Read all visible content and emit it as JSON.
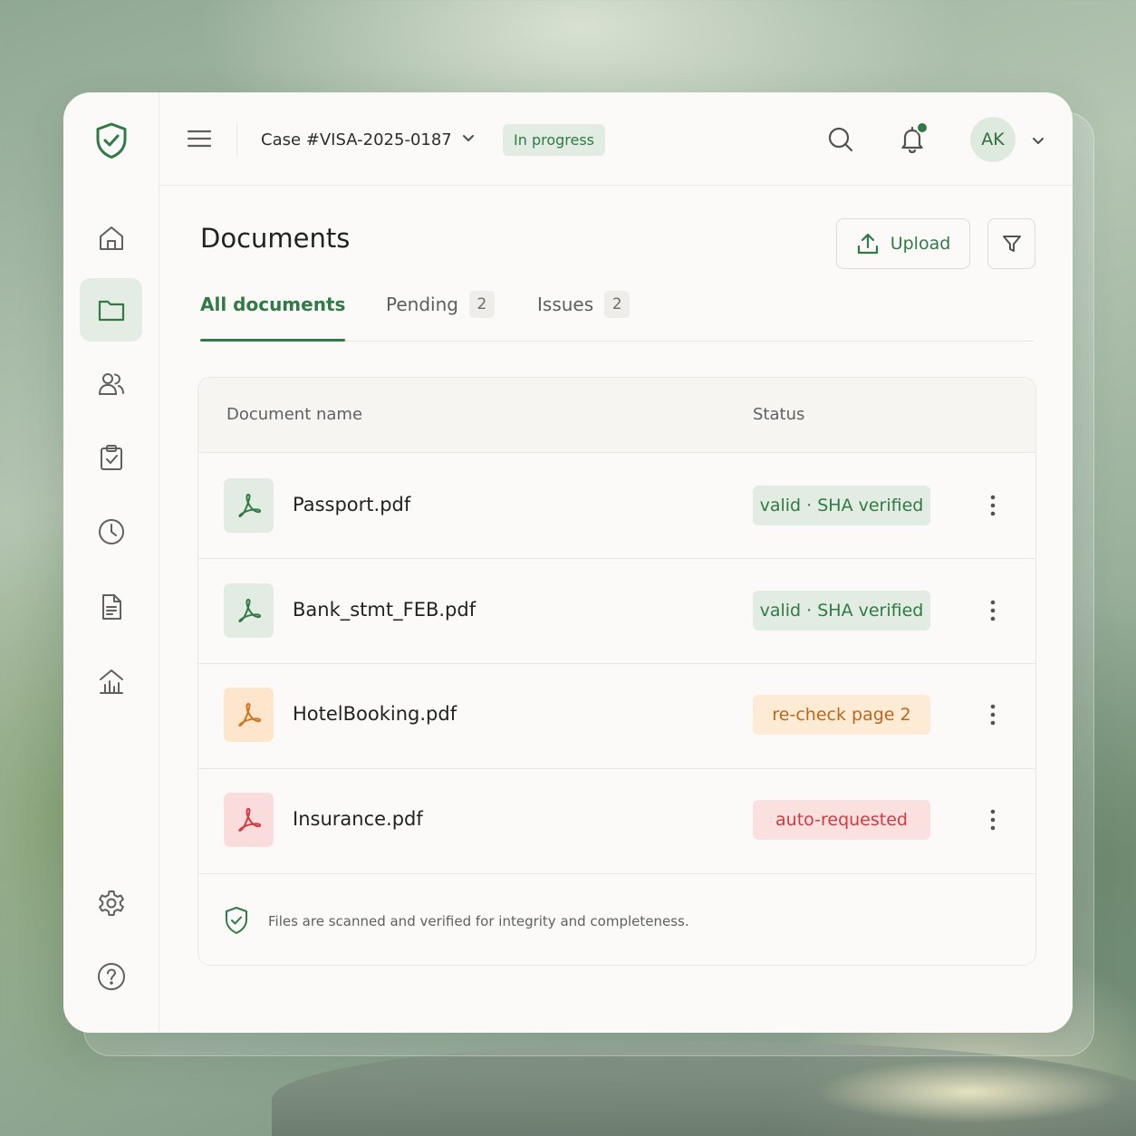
{
  "header": {
    "case_label": "Case #VISA-2025-0187",
    "case_status": "In progress",
    "avatar_initials": "AK"
  },
  "sidebar": {
    "items": [
      {
        "icon": "home-icon",
        "active": false
      },
      {
        "icon": "folder-icon",
        "active": true
      },
      {
        "icon": "users-icon",
        "active": false
      },
      {
        "icon": "clipboard-check-icon",
        "active": false
      },
      {
        "icon": "clock-icon",
        "active": false
      },
      {
        "icon": "file-text-icon",
        "active": false
      },
      {
        "icon": "chart-house-icon",
        "active": false
      },
      {
        "icon": "gear-icon",
        "active": false
      },
      {
        "icon": "help-icon",
        "active": false
      }
    ]
  },
  "main": {
    "title": "Documents",
    "upload_label": "Upload",
    "tabs": [
      {
        "label": "All documents",
        "count": null,
        "active": true
      },
      {
        "label": "Pending",
        "count": "2",
        "active": false
      },
      {
        "label": "Issues",
        "count": "2",
        "active": false
      }
    ],
    "table": {
      "columns": [
        "Document name",
        "Status"
      ],
      "rows": [
        {
          "name": "Passport.pdf",
          "status": "valid · SHA verified",
          "tone": "green"
        },
        {
          "name": "Bank_stmt_FEB.pdf",
          "status": "valid · SHA verified",
          "tone": "green"
        },
        {
          "name": "HotelBooking.pdf",
          "status": "re-check page 2",
          "tone": "orange"
        },
        {
          "name": "Insurance.pdf",
          "status": "auto-requested",
          "tone": "red"
        }
      ],
      "footer_note": "Files are scanned and verified for integrity and completeness."
    }
  },
  "colors": {
    "accent": "#2f7a45",
    "green_bg": "#e2ece2",
    "orange_bg": "#fdebd6",
    "orange_text": "#c0661a",
    "red_bg": "#fbe0e0",
    "red_text": "#d2393e"
  }
}
